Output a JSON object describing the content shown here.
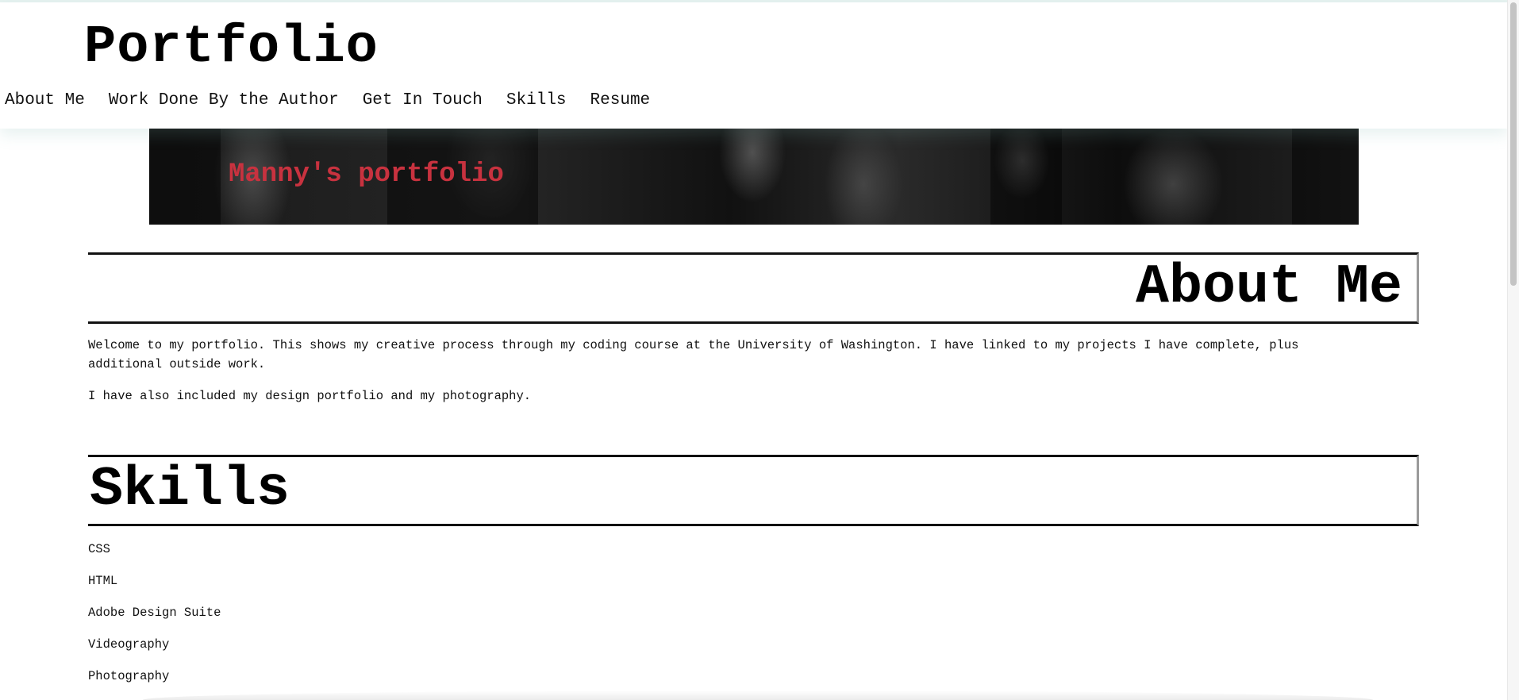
{
  "header": {
    "brand": "Portfolio",
    "nav": [
      "About Me",
      "Work Done By the Author",
      "Get In Touch",
      "Skills",
      "Resume"
    ]
  },
  "banner": {
    "title": "Manny's portfolio",
    "title_color": "#c8323f"
  },
  "about": {
    "heading": "About Me",
    "paragraphs": [
      "Welcome to my portfolio. This shows my creative process through my coding course at the University of Washington. I have linked to my projects I have complete, plus additional outside work.",
      "I have also included my design portfolio and my photography."
    ]
  },
  "skills": {
    "heading": "Skills",
    "items": [
      "CSS",
      "HTML",
      "Adobe Design Suite",
      "Videography",
      "Photography"
    ]
  }
}
